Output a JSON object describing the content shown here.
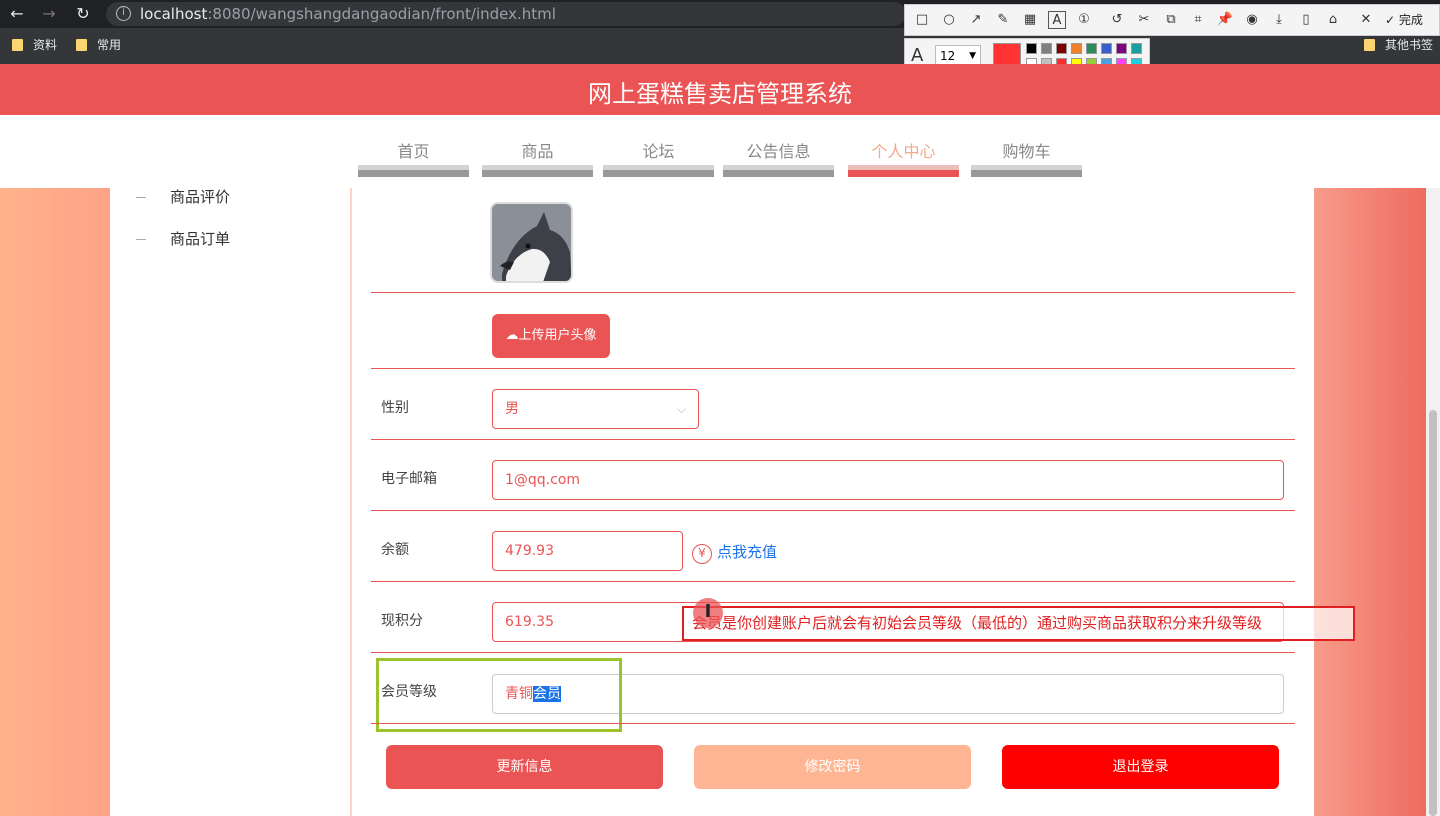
{
  "browser": {
    "url_host": "localhost",
    "url_rest": ":8080/wangshangdangaodian/front/index.html",
    "bookmarks": [
      "资料",
      "常用"
    ],
    "other_bookmarks": "其他书签"
  },
  "snip_tool": {
    "done_label": "完成",
    "font_size": "12",
    "icons": [
      "rect-icon",
      "circle-icon",
      "arrow-icon",
      "pen-icon",
      "mosaic-icon",
      "text-icon",
      "number-icon",
      "undo-icon",
      "scissors-icon",
      "translate-icon",
      "ocr-icon",
      "pin-icon",
      "record-icon",
      "download-icon",
      "save-icon",
      "bookmark-icon",
      "close-icon",
      "check-icon"
    ],
    "active_color": "#ff3333",
    "palette": [
      "#000000",
      "#808080",
      "#800000",
      "#f07f2a",
      "#2e8b57",
      "#3a5fcd",
      "#800080",
      "#1a9e9e",
      "#ffffff",
      "#c0c0c0",
      "#ff2a2a",
      "#ffff00",
      "#9acd32",
      "#4aa3df",
      "#ff40ff",
      "#20d0e0"
    ]
  },
  "site": {
    "title": "网上蛋糕售卖店管理系统",
    "nav": [
      "首页",
      "商品",
      "论坛",
      "公告信息",
      "个人中心",
      "购物车"
    ],
    "active_nav": "个人中心",
    "accent": "#ea5455"
  },
  "sidebar": {
    "items": [
      "商品评价",
      "商品订单"
    ]
  },
  "profile": {
    "upload_label": "上传用户头像",
    "gender_label": "性别",
    "gender_value": "男",
    "email_label": "电子邮箱",
    "email_value": "1@qq.com",
    "balance_label": "余额",
    "balance_value": "479.93",
    "recharge_label": "点我充值",
    "points_label": "现积分",
    "points_value": "619.35",
    "level_label": "会员等级",
    "level_value_a": "青铜",
    "level_value_b": "会员"
  },
  "annotation": {
    "text": "会员是你创建账户后就会有初始会员等级（最低的）通过购买商品获取积分来升级等级"
  },
  "buttons": {
    "update": "更新信息",
    "change_password": "修改密码",
    "logout": "退出登录"
  }
}
